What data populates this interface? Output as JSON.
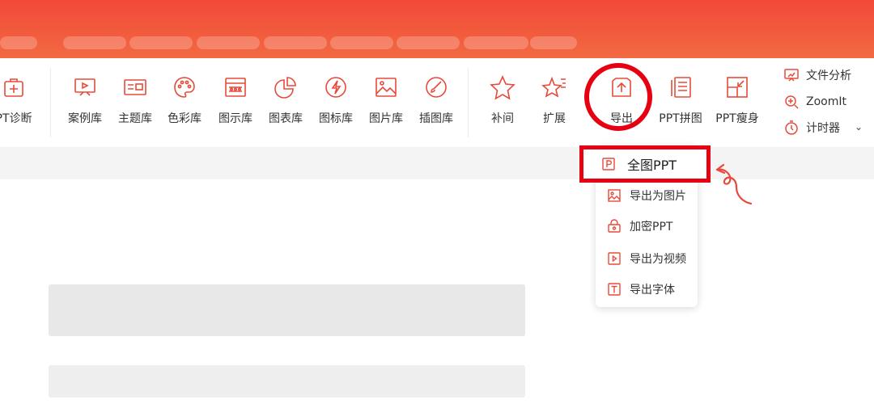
{
  "ribbon": {
    "tools": [
      {
        "label": "PT诊断",
        "icon": "add-box-icon"
      },
      {
        "label": "案例库",
        "icon": "presentation-board-icon"
      },
      {
        "label": "主题库",
        "icon": "theme-card-icon"
      },
      {
        "label": "色彩库",
        "icon": "palette-icon"
      },
      {
        "label": "图示库",
        "icon": "diagram-grid-icon"
      },
      {
        "label": "图表库",
        "icon": "pie-chart-icon"
      },
      {
        "label": "图标库",
        "icon": "lightning-icon"
      },
      {
        "label": "图片库",
        "icon": "image-icon"
      },
      {
        "label": "插图库",
        "icon": "brush-icon"
      },
      {
        "label": "补间",
        "icon": "star-icon"
      },
      {
        "label": "扩展",
        "icon": "star-sparkle-icon"
      },
      {
        "label": "导出",
        "icon": "export-upload-icon"
      },
      {
        "label": "PPT拼图",
        "icon": "stacked-pages-icon"
      },
      {
        "label": "PPT瘦身",
        "icon": "compress-icon"
      }
    ],
    "side": [
      {
        "label": "文件分析",
        "icon": "file-analysis-icon"
      },
      {
        "label": "ZoomIt",
        "icon": "zoom-in-icon"
      },
      {
        "label": "计时器",
        "icon": "timer-icon"
      }
    ]
  },
  "dropdown": {
    "items": [
      {
        "label": "全图PPT",
        "icon": "ppt-p-icon"
      },
      {
        "label": "导出为图片",
        "icon": "picture-icon"
      },
      {
        "label": "加密PPT",
        "icon": "lock-icon"
      },
      {
        "label": "导出为视频",
        "icon": "video-icon"
      },
      {
        "label": "导出字体",
        "icon": "text-t-icon"
      }
    ]
  },
  "colors": {
    "accent": "#e60012",
    "brand": "#f24a3a"
  }
}
